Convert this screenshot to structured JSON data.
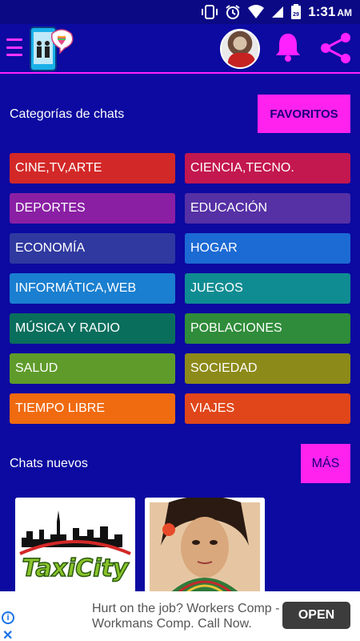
{
  "status_bar": {
    "time": "1:31",
    "ampm": "AM",
    "calendar_day": "29"
  },
  "header": {
    "menu_icon": "hamburger-menu-icon",
    "logo_icon": "phone-chat-heart-logo",
    "avatar_icon": "user-avatar",
    "bell_icon": "bell-icon",
    "share_icon": "share-icon",
    "accent_color": "#ff22ff"
  },
  "categories_section": {
    "title": "Categorías de chats",
    "favorites_label": "FAVORITOS",
    "items": [
      {
        "label": "CINE,TV,ARTE",
        "color": "#d32828"
      },
      {
        "label": "CIENCIA,TECNO.",
        "color": "#c3174f"
      },
      {
        "label": "DEPORTES",
        "color": "#8a1fa4"
      },
      {
        "label": "EDUCACIÓN",
        "color": "#5630a5"
      },
      {
        "label": "ECONOMÍA",
        "color": "#3039a0"
      },
      {
        "label": "HOGAR",
        "color": "#1c6ad4"
      },
      {
        "label": "INFORMÁTICA,WEB",
        "color": "#1a7fd0"
      },
      {
        "label": "JUEGOS",
        "color": "#0f8c92"
      },
      {
        "label": "MÚSICA Y RADIO",
        "color": "#0a6e5c"
      },
      {
        "label": "POBLACIONES",
        "color": "#2f8c3a"
      },
      {
        "label": "SALUD",
        "color": "#5f9b2a"
      },
      {
        "label": "SOCIEDAD",
        "color": "#8c8a18"
      },
      {
        "label": "TIEMPO LIBRE",
        "color": "#f06a10"
      },
      {
        "label": "VIAJES",
        "color": "#e0461a"
      }
    ]
  },
  "new_chats_section": {
    "title": "Chats nuevos",
    "more_label": "MÁS",
    "cards": [
      {
        "icon": "taxi-city-logo"
      },
      {
        "icon": "woman-with-fan-photo"
      }
    ]
  },
  "ad_banner": {
    "text": "Hurt on the job? Workers Comp - Workmans Comp. Call Now.",
    "button_label": "OPEN",
    "info_icon": "info-icon",
    "close_icon": "close-icon"
  }
}
